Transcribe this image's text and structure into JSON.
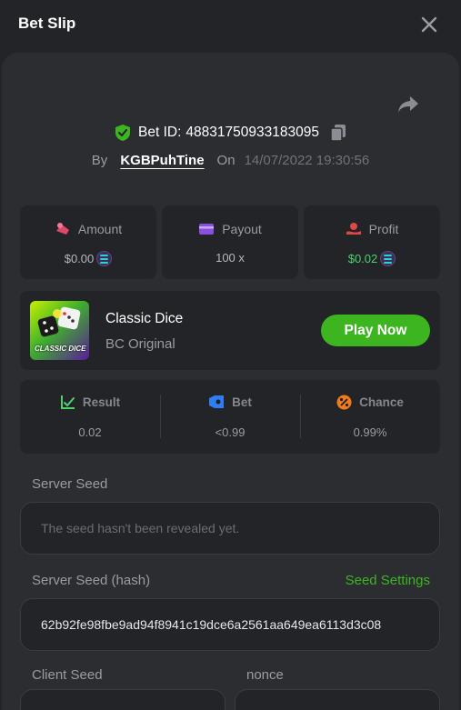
{
  "header": {
    "title": "Bet Slip"
  },
  "bet": {
    "id_label": "Bet ID:",
    "id_value": "48831750933183095",
    "by_label": "By",
    "user": "KGBPuhTine",
    "on_label": "On",
    "date": "14/07/2022 19:30:56"
  },
  "stats": [
    {
      "label": "Amount",
      "value": "$0.00"
    },
    {
      "label": "Payout",
      "value": "100 x"
    },
    {
      "label": "Profit",
      "value": "$0.02"
    }
  ],
  "game": {
    "thumb_text": "CLASSIC DICE",
    "name": "Classic Dice",
    "provider": "BC Original",
    "play_label": "Play Now"
  },
  "result": [
    {
      "label": "Result",
      "value": "0.02"
    },
    {
      "label": "Bet",
      "value": "<0.99"
    },
    {
      "label": "Chance",
      "value": "0.99%"
    }
  ],
  "server_seed": {
    "label": "Server Seed",
    "placeholder": "The seed hasn't been revealed yet."
  },
  "server_seed_hash": {
    "label": "Server Seed (hash)",
    "settings_link": "Seed Settings",
    "value": "62b92fe98fbe9ad94f8941c19dce6a2561aa649ea6113d3c08"
  },
  "client_seed": {
    "label": "Client Seed"
  },
  "nonce": {
    "label": "nonce"
  },
  "colors": {
    "accent_green": "#3cb521",
    "profit_green": "#4fd16a",
    "background": "#232427",
    "panel": "#2b2d31"
  }
}
